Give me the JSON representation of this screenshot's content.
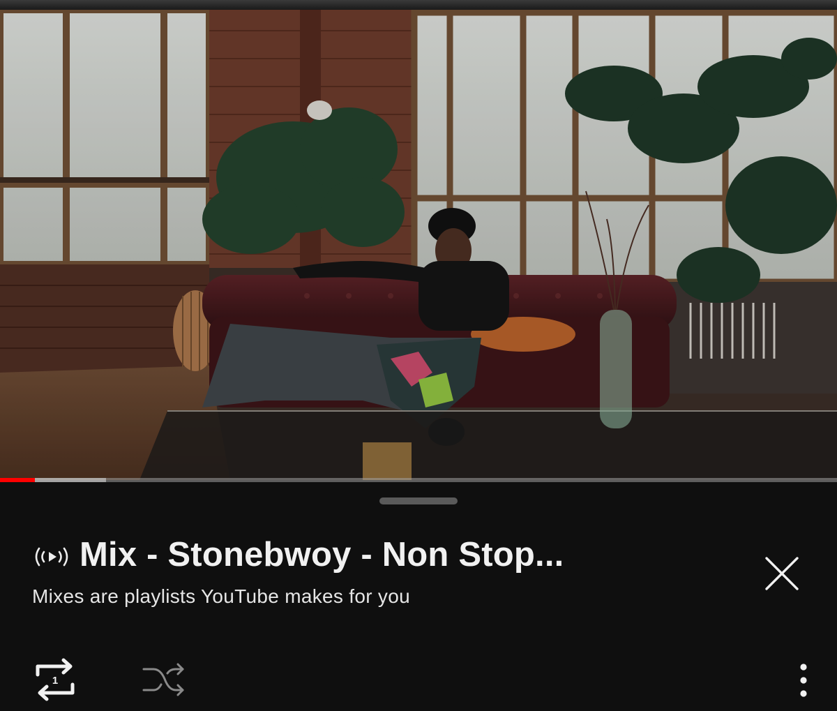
{
  "video": {
    "description_icon": "music-video-frame",
    "progress_percent": 4.2,
    "buffered_percent": 12.7
  },
  "playlist": {
    "icon": "mix-icon",
    "title": "Mix - Stonebwoy - Non Stop...",
    "subtitle": "Mixes are playlists YouTube makes for you"
  },
  "controls": {
    "close_icon": "close-icon",
    "repeat_icon": "repeat-one-icon",
    "repeat_badge": "1",
    "shuffle_icon": "shuffle-icon",
    "more_icon": "more-vert-icon"
  },
  "colors": {
    "background": "#0f0f0f",
    "progress": "#ff0000",
    "text_primary": "#f1f1f1",
    "icon_dim": "#8a8a8a"
  }
}
